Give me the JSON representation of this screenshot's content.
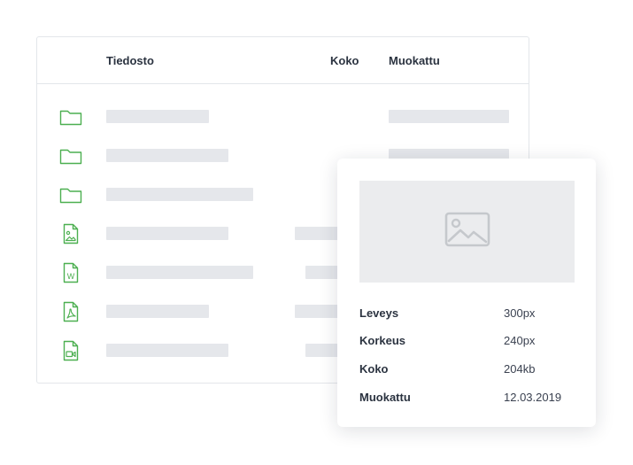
{
  "columns": {
    "name": "Tiedosto",
    "size": "Koko",
    "modified": "Muokattu"
  },
  "rows": [
    {
      "type": "folder-icon"
    },
    {
      "type": "folder-icon"
    },
    {
      "type": "folder-icon"
    },
    {
      "type": "image-file-icon"
    },
    {
      "type": "word-file-icon",
      "letter": "W"
    },
    {
      "type": "pdf-file-icon"
    },
    {
      "type": "video-file-icon"
    }
  ],
  "details": {
    "items": [
      {
        "label": "Leveys",
        "value": "300px"
      },
      {
        "label": "Korkeus",
        "value": "240px"
      },
      {
        "label": "Koko",
        "value": "204kb"
      },
      {
        "label": "Muokattu",
        "value": "12.03.2019"
      }
    ]
  },
  "colors": {
    "accent": "#4caf50",
    "placeholder": "#e5e7eb",
    "preview_bg": "#ebecee"
  }
}
